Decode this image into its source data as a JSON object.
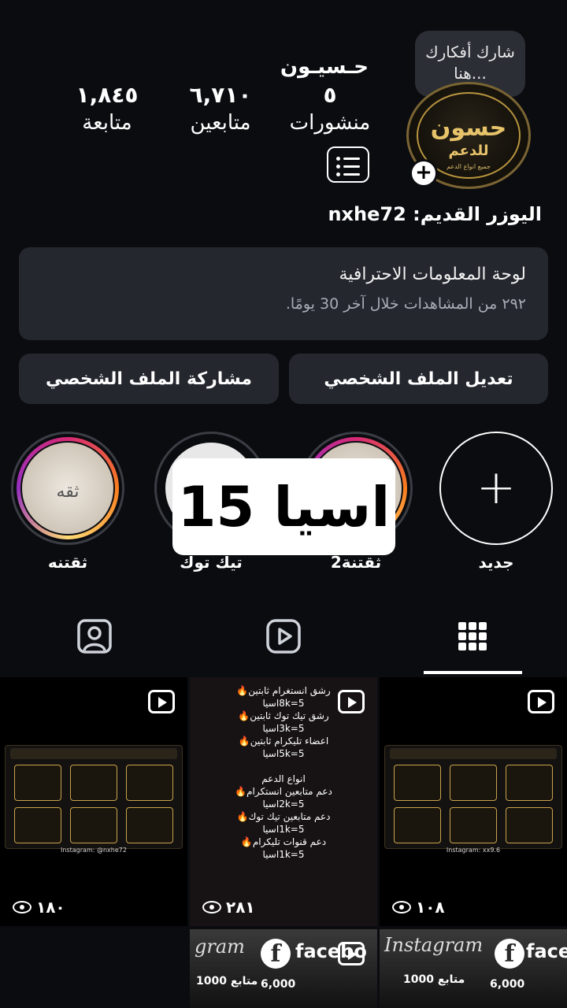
{
  "profile": {
    "thought_bubble": "شارك أفكارك\nهنا...",
    "name": "حـسيـون",
    "avatar_main": "حسون",
    "avatar_sub": "للدعم",
    "avatar_line": "جميع انواع الدعم",
    "stats": {
      "posts_value": "٥",
      "posts_label": "منشورات",
      "followers_value": "٦,٧١٠",
      "followers_label": "متابعين",
      "following_value": "١,٨٤٥",
      "following_label": "متابعة"
    },
    "old_username_label": "اليوزر القديم:",
    "old_username": "nxhe72"
  },
  "dashboard": {
    "title": "لوحة المعلومات الاحترافية",
    "subtitle": "٢٩٢ من المشاهدات خلال آخر 30 يومًا."
  },
  "buttons": {
    "edit_profile": "تعديل الملف الشخصي",
    "share_profile": "مشاركة الملف الشخصي"
  },
  "highlights": [
    {
      "label": "جديد"
    },
    {
      "label": "ثقتنة2"
    },
    {
      "label": "تيك توك"
    },
    {
      "label": "ثقتنه",
      "inner_text": "ثقه"
    }
  ],
  "overlay_text": "15 اسيا",
  "posts": [
    {
      "views": "١٨٠",
      "ig": "Instagram: @nxhe72"
    },
    {
      "views": "٢٨١",
      "lines": [
        "رشق انستغرام ثابتين🔥",
        "8k=5اسيا",
        "رشق تيك توك ثابتين🔥",
        "3k=5اسيا",
        "اعضاء تليكرام ثابتين🔥",
        "5k=5اسيا",
        "انواع الدعم",
        "دعم متابعين انستكرام🔥",
        "2k=5اسيا",
        "دعم متابعين تيك توك🔥",
        "1k=5اسيا",
        "دعم قنوات تليكرام🔥",
        "1k=5اسيا"
      ]
    },
    {
      "views": "١٠٨",
      "ig": "Instagram: xx9.6"
    }
  ],
  "bottom_posts": [
    {
      "brand": "facebo",
      "left_text": "gram",
      "value": "6,000"
    },
    {
      "brand": "facebo",
      "left_text": "Instagram",
      "value": "6,000",
      "sub": "1000 متابع"
    }
  ],
  "bottom_extra": {
    "left_sub": "1000 متابع"
  }
}
